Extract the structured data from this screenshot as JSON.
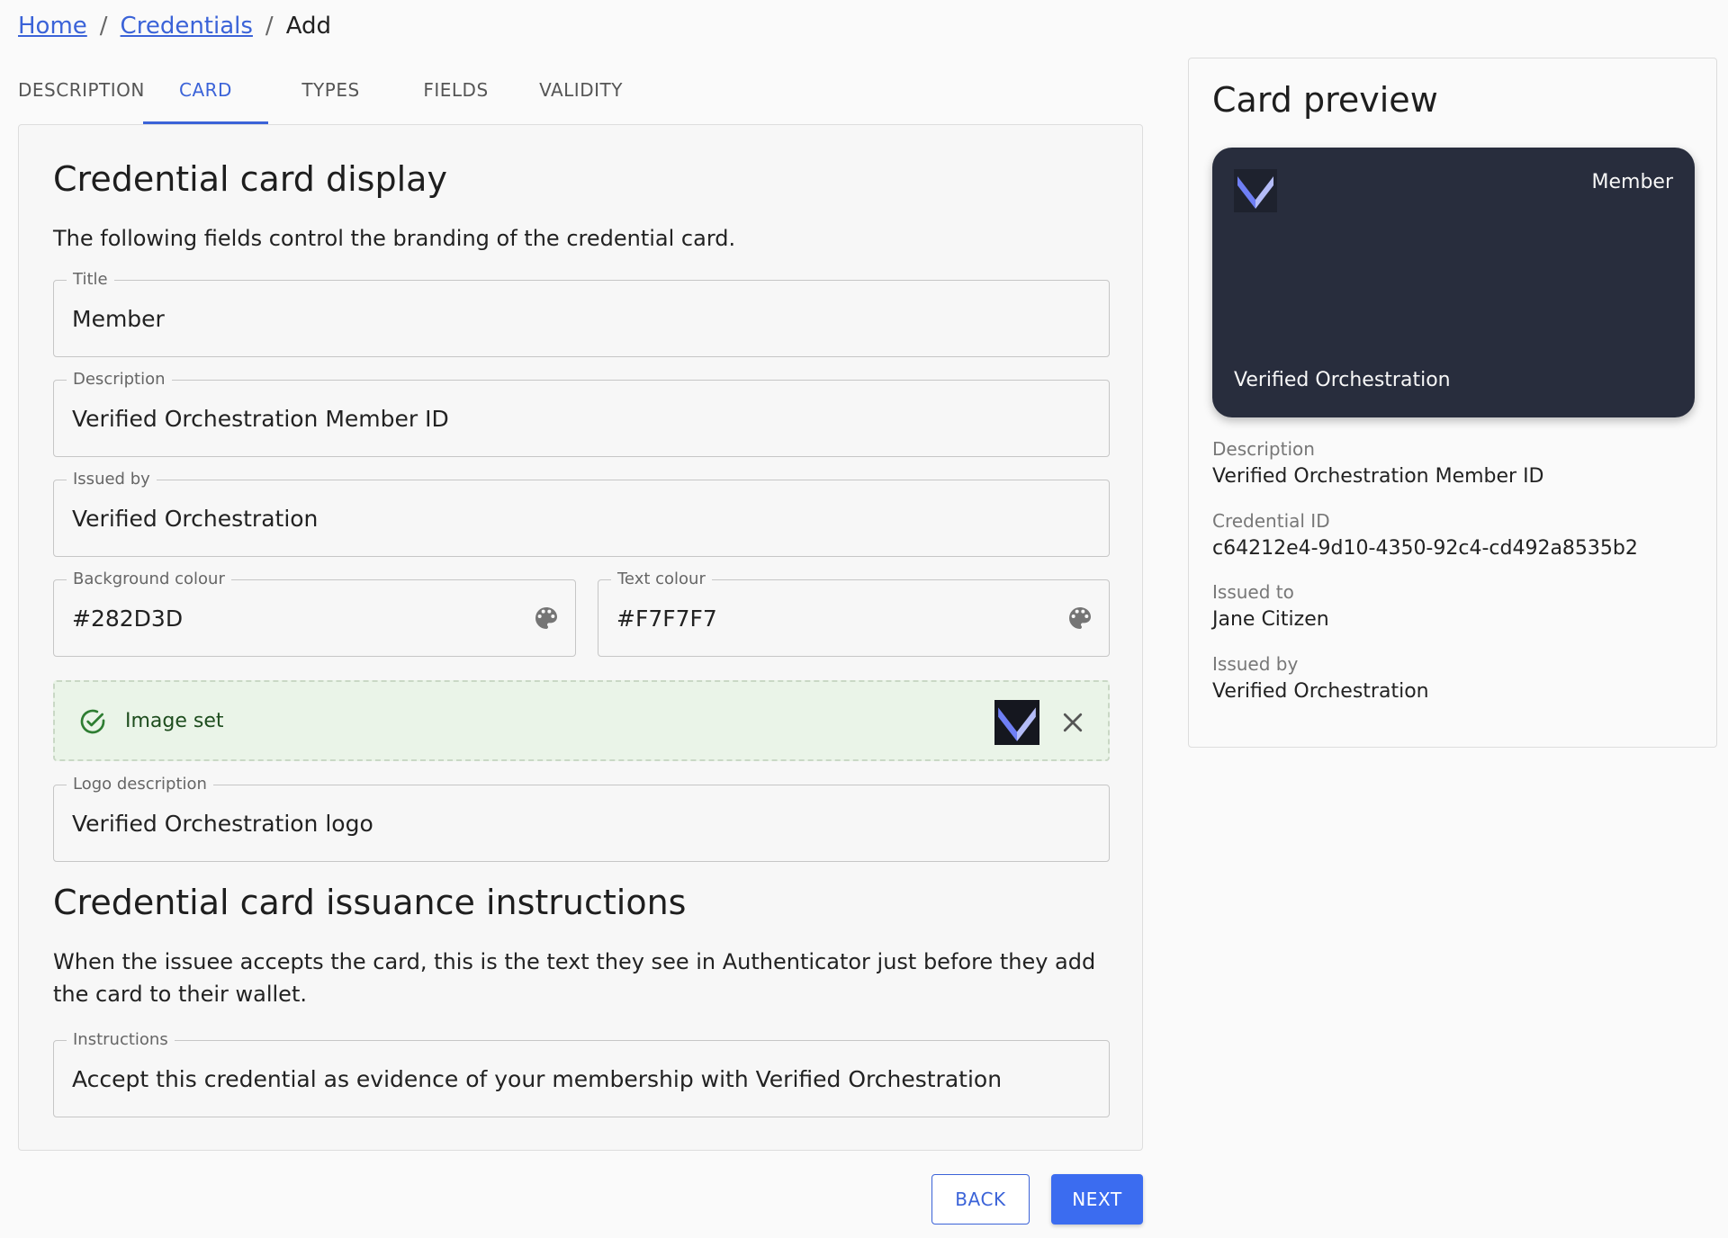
{
  "breadcrumb": {
    "home": "Home",
    "credentials": "Credentials",
    "current": "Add",
    "separator": "/"
  },
  "tabs": [
    {
      "label": "DESCRIPTION"
    },
    {
      "label": "CARD",
      "active": true
    },
    {
      "label": "TYPES"
    },
    {
      "label": "FIELDS"
    },
    {
      "label": "VALIDITY"
    }
  ],
  "card_display": {
    "heading": "Credential card display",
    "intro": "The following fields control the branding of the credential card.",
    "title": {
      "label": "Title",
      "value": "Member"
    },
    "description": {
      "label": "Description",
      "value": "Verified Orchestration Member ID"
    },
    "issued_by": {
      "label": "Issued by",
      "value": "Verified Orchestration"
    },
    "background_colour": {
      "label": "Background colour",
      "value": "#282D3D",
      "icon": "palette-icon"
    },
    "text_colour": {
      "label": "Text colour",
      "value": "#F7F7F7",
      "icon": "palette-icon"
    },
    "image": {
      "status": "Image set",
      "status_icon": "check-circle-icon",
      "clear_icon": "close-icon"
    },
    "logo_description": {
      "label": "Logo description",
      "value": "Verified Orchestration logo"
    }
  },
  "issuance": {
    "heading": "Credential card issuance instructions",
    "intro": "When the issuee accepts the card, this is the text they see in Authenticator just before they add the card to their wallet.",
    "instructions": {
      "label": "Instructions",
      "value": "Accept this credential as evidence of your membership with Verified Orchestration"
    }
  },
  "buttons": {
    "back": "BACK",
    "next": "NEXT"
  },
  "preview": {
    "heading": "Card preview",
    "card": {
      "title": "Member",
      "issuer": "Verified Orchestration",
      "background": "#282D3D",
      "text_color": "#F7F7F7"
    },
    "details": [
      {
        "label": "Description",
        "value": "Verified Orchestration Member ID"
      },
      {
        "label": "Credential ID",
        "value": "c64212e4-9d10-4350-92c4-cd492a8535b2"
      },
      {
        "label": "Issued to",
        "value": "Jane Citizen"
      },
      {
        "label": "Issued by",
        "value": "Verified Orchestration"
      }
    ]
  },
  "colors": {
    "accent": "#3B63D8",
    "success_bg": "#EAF4E8",
    "success_text": "#1E4D1E"
  }
}
